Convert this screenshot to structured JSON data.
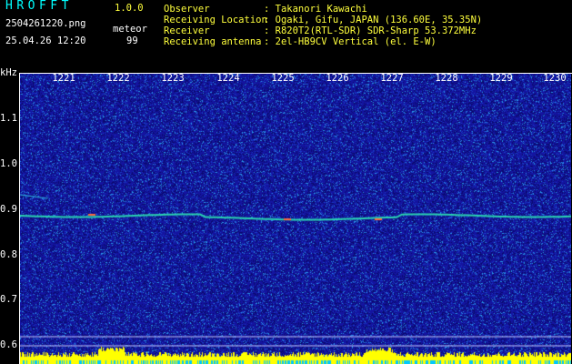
{
  "app": {
    "title": "HROFFT",
    "version": "1.0.0"
  },
  "file_name": "2504261220.png",
  "timestamp": "25.04.26 12:20",
  "detection": {
    "label": "meteor",
    "count": "99"
  },
  "info": [
    {
      "label": "Observer",
      "value": ": Takanori Kawachi"
    },
    {
      "label": "Receiving Location",
      "value": ": Ogaki, Gifu, JAPAN (136.60E, 35.35N)"
    },
    {
      "label": "Receiver",
      "value": ": R820T2(RTL-SDR) SDR-Sharp 53.372MHz"
    },
    {
      "label": "Receiving antenna",
      "value": ": 2el-HB9CV Vertical (el. E-W)"
    }
  ],
  "axes": {
    "y_unit": "kHz",
    "x_ticks": [
      "1221",
      "1222",
      "1223",
      "1224",
      "1225",
      "1226",
      "1227",
      "1228",
      "1229",
      "1230"
    ],
    "y_ticks": [
      "1.1",
      "1.0",
      "0.9",
      "0.8",
      "0.7",
      "0.6"
    ]
  },
  "colors": {
    "background": "#1a1ab4",
    "header_text": "#ffff3c",
    "title": "#00ffff",
    "echo_trace": "#40ffc0",
    "noise_floor": "#ffff00"
  }
}
